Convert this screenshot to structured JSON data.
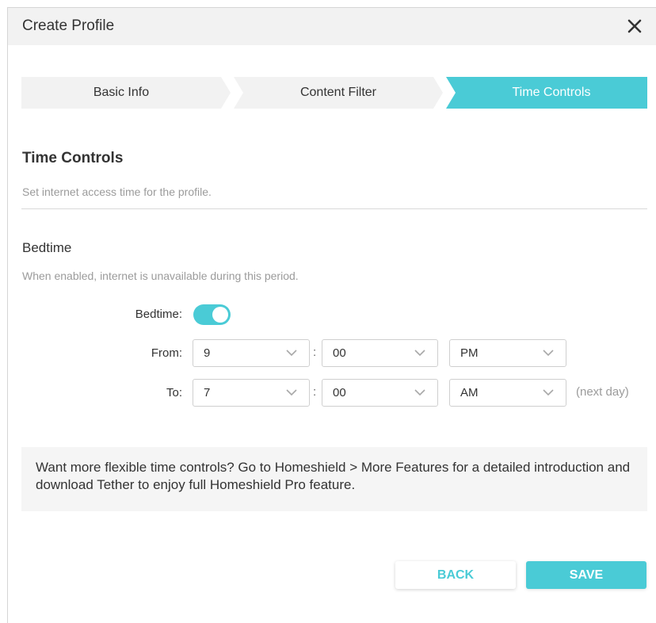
{
  "dialog": {
    "title": "Create Profile"
  },
  "steps": [
    {
      "label": "Basic Info",
      "state": "done"
    },
    {
      "label": "Content Filter",
      "state": "done"
    },
    {
      "label": "Time Controls",
      "state": "active"
    }
  ],
  "section": {
    "title": "Time Controls",
    "description": "Set internet access time for the profile."
  },
  "bedtime": {
    "title": "Bedtime",
    "description": "When enabled, internet is unavailable during this period.",
    "toggle_label": "Bedtime:",
    "toggle_on": true,
    "from_label": "From:",
    "to_label": "To:",
    "colon": ":",
    "from": {
      "hour": "9",
      "minute": "00",
      "period": "PM"
    },
    "to": {
      "hour": "7",
      "minute": "00",
      "period": "AM"
    },
    "next_day_note": "(next day)"
  },
  "info": {
    "text": "Want more flexible time controls? Go to Homeshield > More Features for a detailed introduction and download Tether to enjoy full Homeshield Pro feature."
  },
  "buttons": {
    "back": "BACK",
    "save": "SAVE"
  },
  "colors": {
    "accent": "#4acbd6",
    "step_inactive": "#f2f2f2",
    "header_bg": "#f2f2f2"
  },
  "icons": {
    "close": "close-icon",
    "dropdown": "chevron-down-icon"
  }
}
